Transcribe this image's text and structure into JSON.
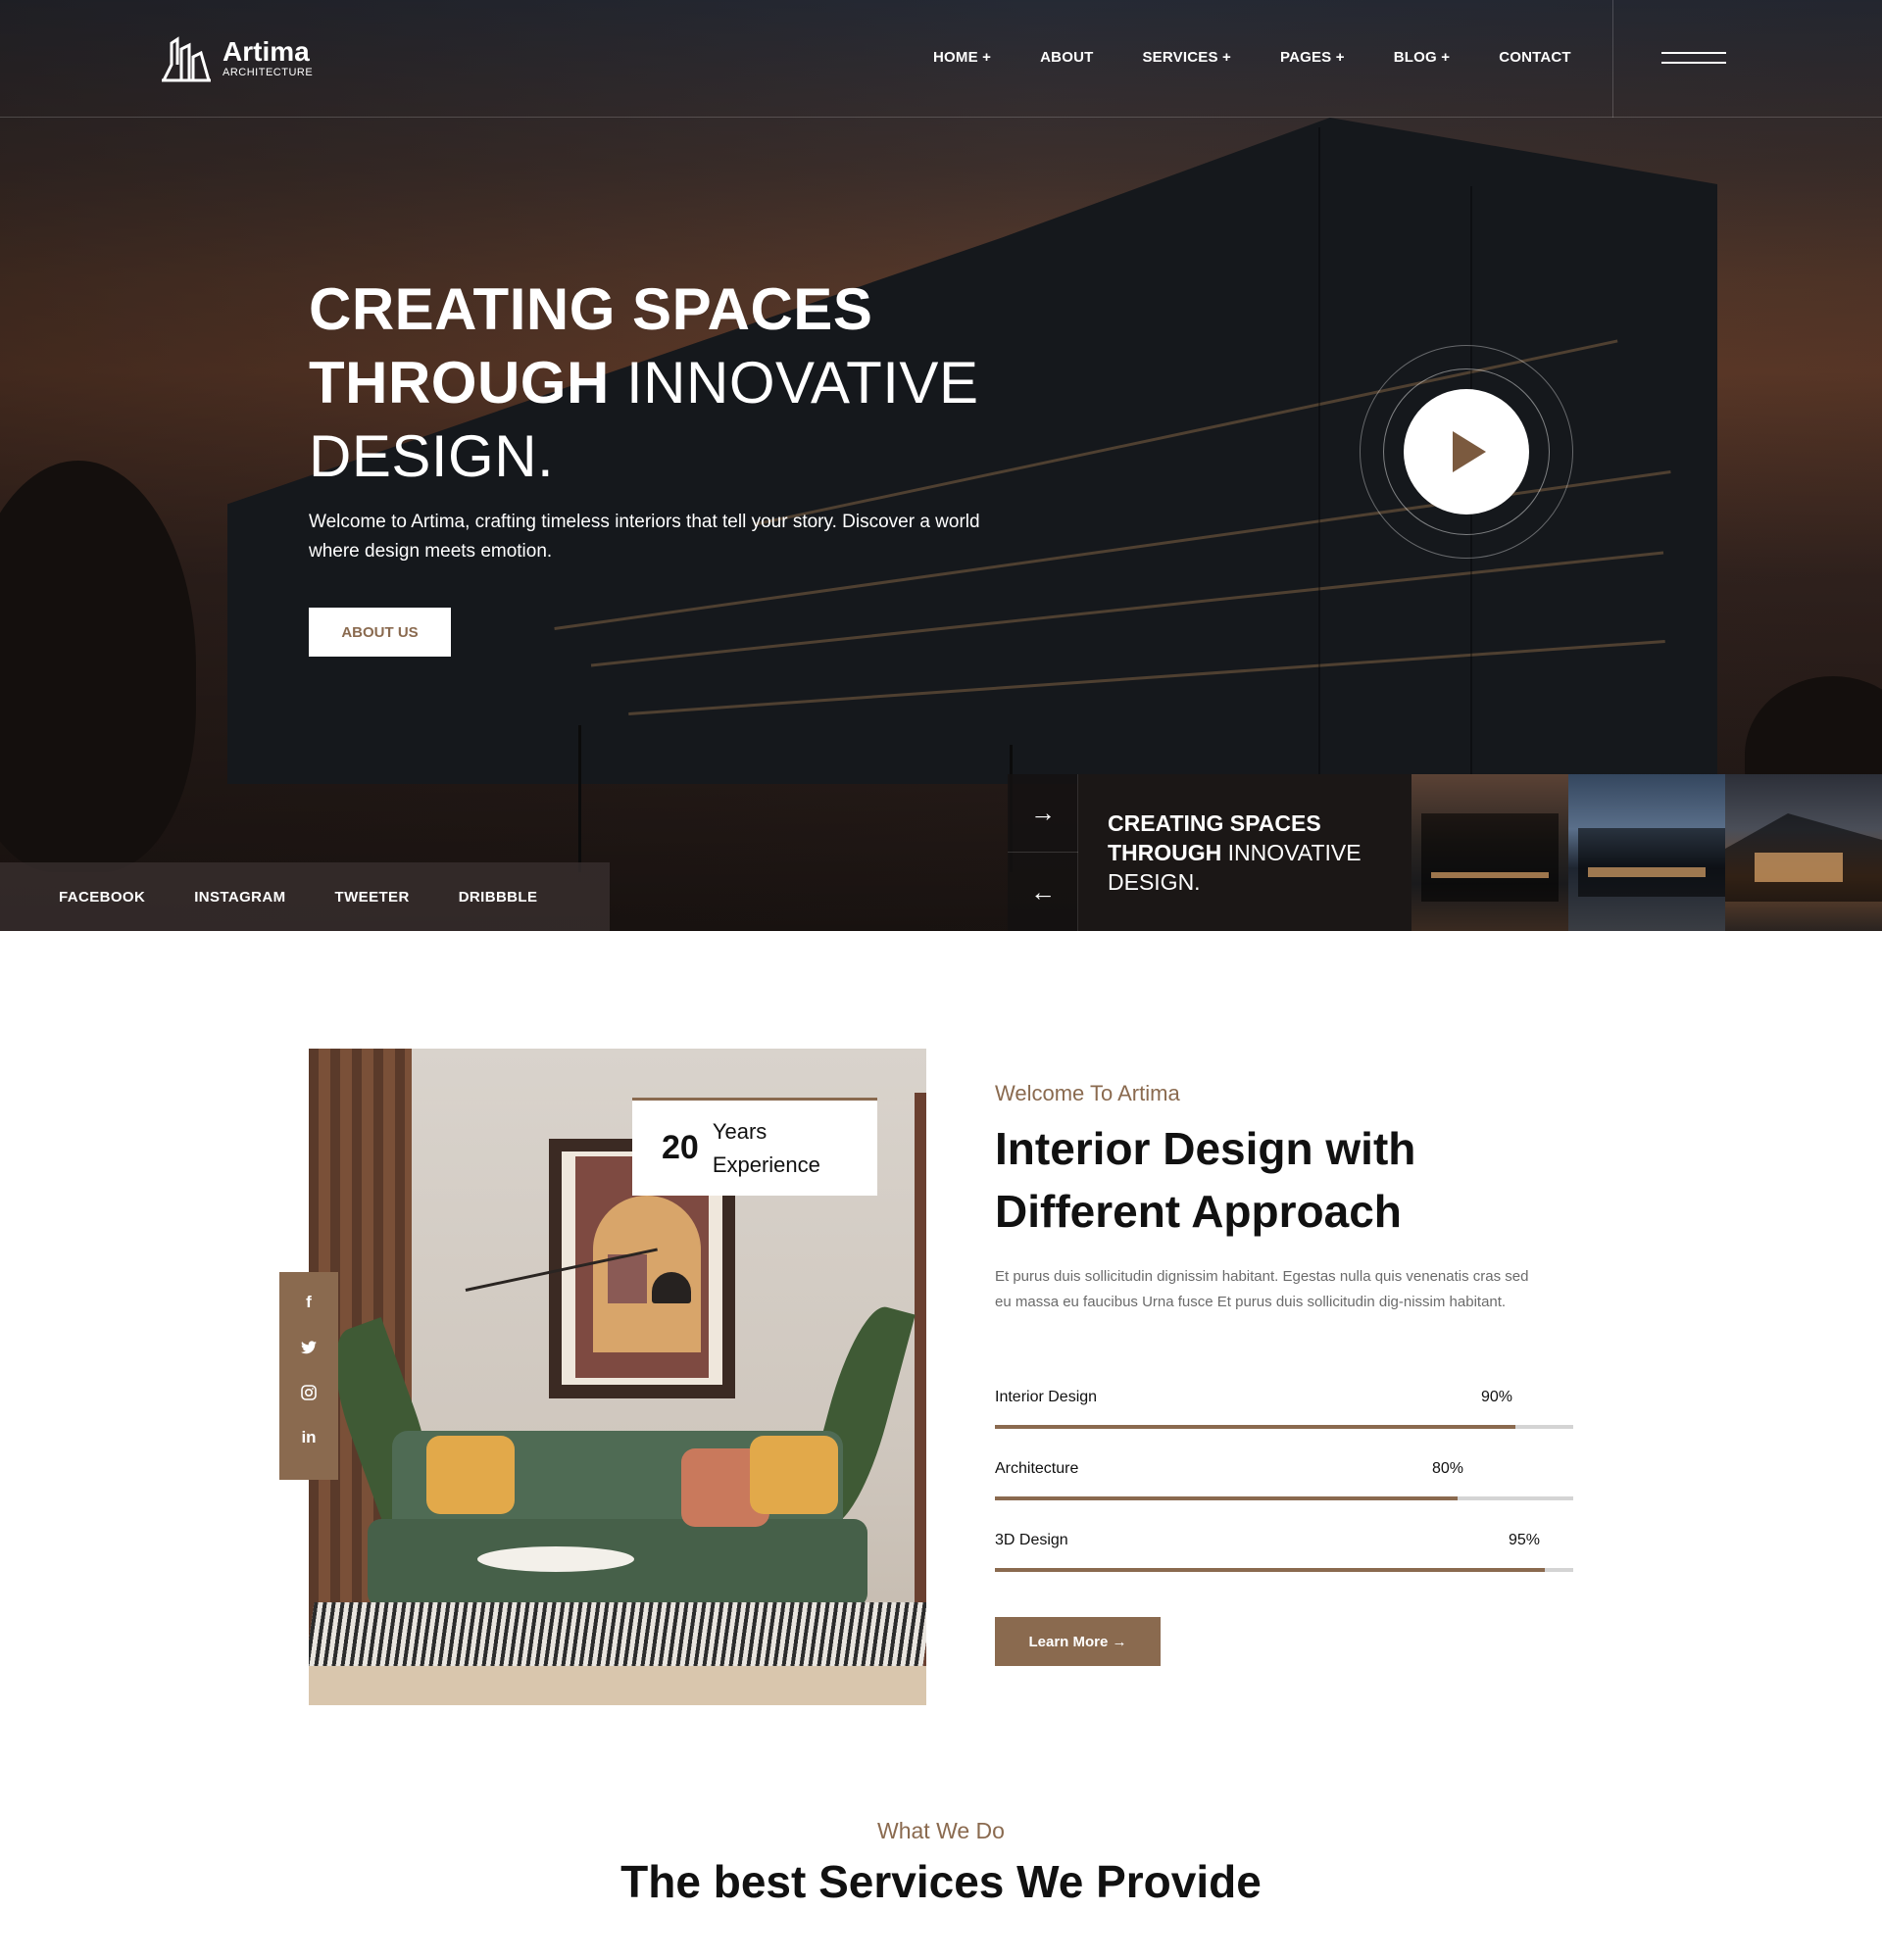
{
  "brand": {
    "name": "Artima",
    "tagline": "ARCHITECTURE",
    "accent": "#8a6a4f"
  },
  "nav": {
    "items": [
      {
        "label": "HOME +"
      },
      {
        "label": "ABOUT"
      },
      {
        "label": "SERVICES +"
      },
      {
        "label": "PAGES +"
      },
      {
        "label": "BLOG +"
      },
      {
        "label": "CONTACT"
      }
    ],
    "menu_icon": "hamburger-icon"
  },
  "hero": {
    "title_line1": "CREATING SPACES",
    "title_line2_bold": "THROUGH",
    "title_line2_thin": " INNOVATIVE",
    "title_line3": "DESIGN.",
    "description": "Welcome to Artima, crafting timeless interiors that tell your story. Discover a world where design meets emotion.",
    "cta_label": "ABOUT US",
    "play_icon": "play-icon"
  },
  "socials": [
    {
      "label": "FACEBOOK"
    },
    {
      "label": "INSTAGRAM"
    },
    {
      "label": "TWEETER"
    },
    {
      "label": "DRIBBBLE"
    }
  ],
  "slider": {
    "next_arrow": "→",
    "prev_arrow": "←",
    "caption_line1": "CREATING SPACES",
    "caption_line2_bold": "THROUGH",
    "caption_line2_thin": " INNOVATIVE",
    "caption_line3": "DESIGN."
  },
  "about": {
    "experience_number": "20",
    "experience_line1": "Years",
    "experience_line2": "Experience",
    "side_socials": [
      {
        "icon": "facebook-icon",
        "glyph": "f"
      },
      {
        "icon": "twitter-icon",
        "glyph": "t"
      },
      {
        "icon": "instagram-icon",
        "glyph": "◎"
      },
      {
        "icon": "linkedin-icon",
        "glyph": "in"
      }
    ],
    "subtitle": "Welcome To Artima",
    "title": "Interior Design with Different Approach",
    "text": "Et purus duis sollicitudin dignissim habitant. Egestas nulla quis venenatis cras sed eu massa eu faucibus Urna fusce Et purus duis sollicitudin dig-nissim habitant.",
    "skills": [
      {
        "name": "Interior Design",
        "percent_label": "90%",
        "value": 90
      },
      {
        "name": "Architecture",
        "percent_label": "80%",
        "value": 80
      },
      {
        "name": "3D Design",
        "percent_label": "95%",
        "value": 95
      }
    ],
    "cta_label": "Learn More →"
  },
  "services": {
    "subtitle": "What We Do",
    "title": "The best Services We Provide"
  }
}
